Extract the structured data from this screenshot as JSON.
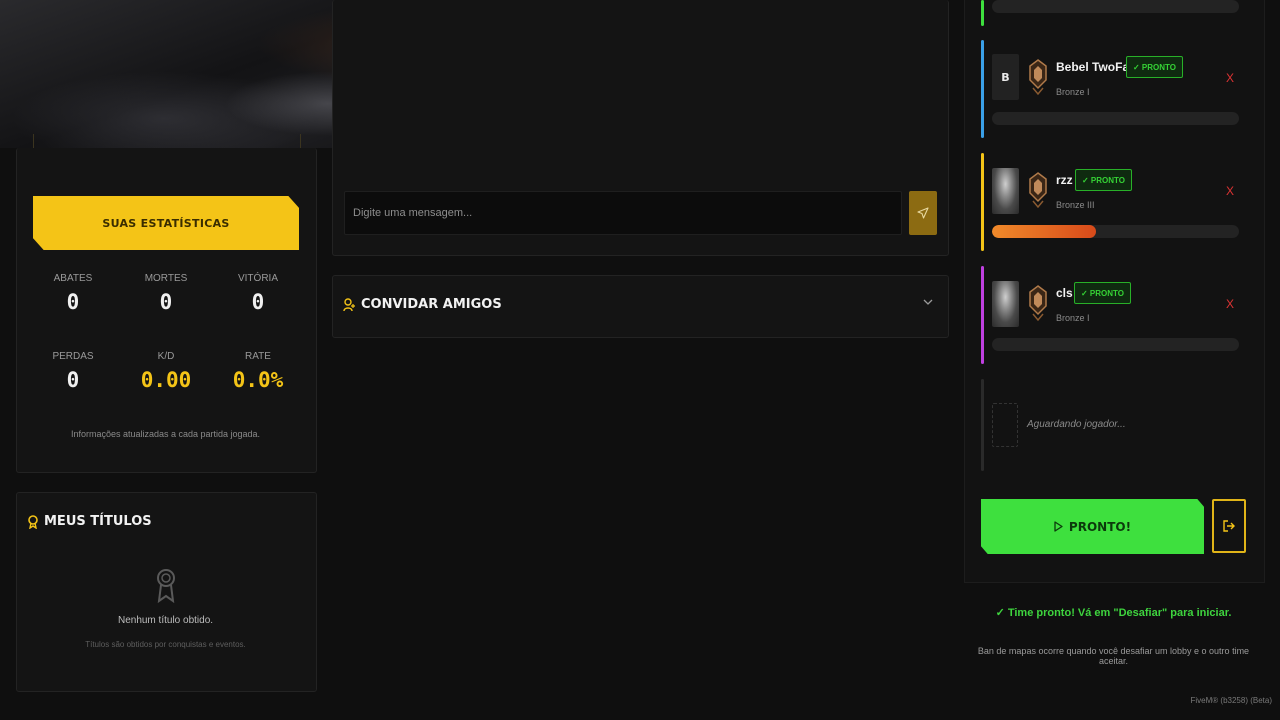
{
  "stats": {
    "button_label": "SUAS ESTATÍSTICAS",
    "items": [
      {
        "label": "ABATES",
        "value": "0"
      },
      {
        "label": "MORTES",
        "value": "0"
      },
      {
        "label": "VITÓRIA",
        "value": "0"
      },
      {
        "label": "PERDAS",
        "value": "0"
      },
      {
        "label": "K/D",
        "value": "0.00"
      },
      {
        "label": "RATE",
        "value": "0.0%"
      }
    ],
    "note": "Informações atualizadas a cada partida jogada."
  },
  "titles": {
    "heading": "MEUS TÍTULOS",
    "empty": "Nenhum título obtido.",
    "empty_sub": "Títulos são obtidos por conquistas e eventos."
  },
  "chat": {
    "input_placeholder": "Digite uma mensagem..."
  },
  "invite": {
    "heading": "CONVIDAR AMIGOS"
  },
  "team": {
    "slots": [
      {
        "avatar_letter": "B",
        "name": "Bebel TwoFast",
        "rank": "Bronze I",
        "status": "✓ PRONTO",
        "kick": "X",
        "bar_color": "#3aa0e8",
        "progress": 0
      },
      {
        "avatar_letter": "",
        "name": "rzz",
        "rank": "Bronze III",
        "status": "✓ PRONTO",
        "kick": "X",
        "bar_color": "#f4c417",
        "progress": 0.42
      },
      {
        "avatar_letter": "",
        "name": "cls",
        "rank": "Bronze I",
        "status": "✓ PRONTO",
        "kick": "X",
        "bar_color": "#c040e0",
        "progress": 0
      }
    ],
    "waiting_text": "Aguardando jogador...",
    "ready_button": "PRONTO!",
    "ready_message": "✓ Time pronto! Vá em \"Desafiar\" para iniciar.",
    "ban_note": "Ban de mapas ocorre quando você desafiar um lobby e o outro time aceitar.",
    "top_bar_color": "#3ee03e"
  },
  "footer": {
    "version": "FiveM® (b3258) (Beta)"
  }
}
